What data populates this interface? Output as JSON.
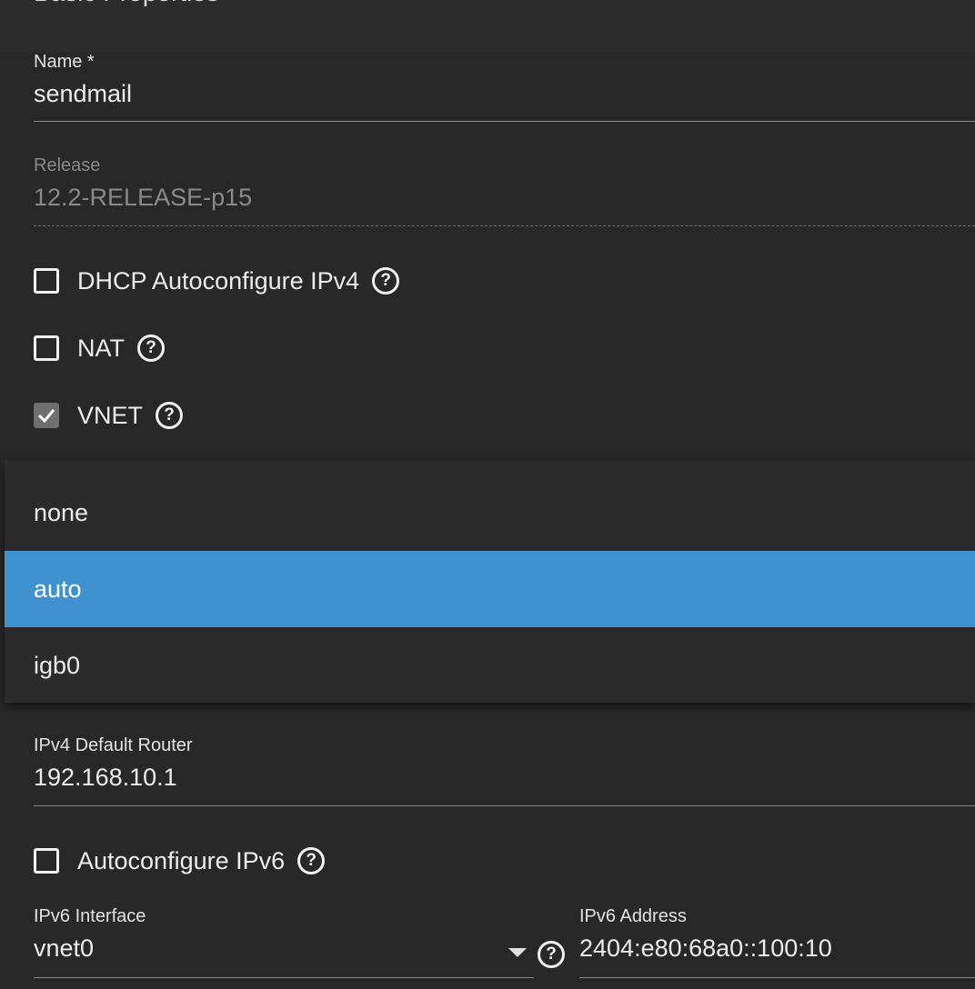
{
  "section": {
    "title": "Basic Properties"
  },
  "name_field": {
    "label": "Name *",
    "value": "sendmail"
  },
  "release_field": {
    "label": "Release",
    "value": "12.2-RELEASE-p15"
  },
  "checkboxes": {
    "dhcp": {
      "label": "DHCP Autoconfigure IPv4",
      "checked": false,
      "help_icon": "help-circle-icon"
    },
    "nat": {
      "label": "NAT",
      "checked": false,
      "help_icon": "help-circle-icon"
    },
    "vnet": {
      "label": "VNET",
      "checked": true,
      "check_icon": "checkmark-icon",
      "help_icon": "help-circle-icon"
    },
    "autoconf_ipv6": {
      "label": "Autoconfigure IPv6",
      "checked": false,
      "help_icon": "help-circle-icon"
    }
  },
  "dropdown": {
    "options": [
      "none",
      "auto",
      "igb0"
    ],
    "selected": "auto",
    "selected_color": "#3f91d0"
  },
  "ipv4_router": {
    "label": "IPv4 Default Router",
    "value": "192.168.10.1"
  },
  "ipv6_interface": {
    "label": "IPv6 Interface",
    "value": "vnet0",
    "caret_icon": "caret-down-icon"
  },
  "ipv6_address": {
    "label": "IPv6 Address",
    "value": "2404:e80:68a0::100:10"
  },
  "help_glyph": "?"
}
